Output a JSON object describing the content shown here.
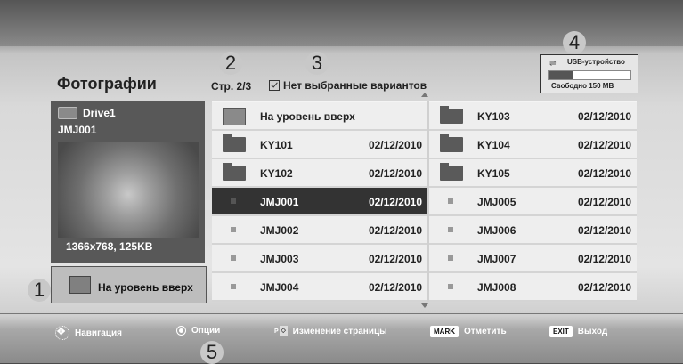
{
  "header": {
    "title": "Фотографии",
    "page": "Стр. 2/3",
    "selection": "Нет выбранные вариантов"
  },
  "callouts": [
    "1",
    "2",
    "3",
    "4",
    "5"
  ],
  "usb": {
    "label": "USB-устройство",
    "free": "Свободно 150 MB",
    "used_fraction": 0.3
  },
  "preview": {
    "drive": "Drive1",
    "file": "JMJ001",
    "info": "1366x768, 125KB"
  },
  "up_button": "На уровень вверх",
  "files": [
    {
      "name": "На уровень вверх",
      "date": "",
      "icon": "up-folder-icon"
    },
    {
      "name": "KY103",
      "date": "02/12/2010",
      "icon": "folder-icon"
    },
    {
      "name": "KY101",
      "date": "02/12/2010",
      "icon": "folder-icon"
    },
    {
      "name": "KY104",
      "date": "02/12/2010",
      "icon": "folder-icon"
    },
    {
      "name": "KY102",
      "date": "02/12/2010",
      "icon": "folder-icon"
    },
    {
      "name": "KY105",
      "date": "02/12/2010",
      "icon": "folder-icon"
    },
    {
      "name": "JMJ001",
      "date": "02/12/2010",
      "icon": "photo-icon",
      "selected": true
    },
    {
      "name": "JMJ005",
      "date": "02/12/2010",
      "icon": "photo-icon"
    },
    {
      "name": "JMJ002",
      "date": "02/12/2010",
      "icon": "photo-icon"
    },
    {
      "name": "JMJ006",
      "date": "02/12/2010",
      "icon": "photo-icon"
    },
    {
      "name": "JMJ003",
      "date": "02/12/2010",
      "icon": "photo-icon"
    },
    {
      "name": "JMJ007",
      "date": "02/12/2010",
      "icon": "photo-icon"
    },
    {
      "name": "JMJ004",
      "date": "02/12/2010",
      "icon": "photo-icon"
    },
    {
      "name": "JMJ008",
      "date": "02/12/2010",
      "icon": "photo-icon"
    }
  ],
  "footer": {
    "nav": "Навигация",
    "options": "Опции",
    "page_key": "P",
    "page_change": "Изменение страницы",
    "mark_key": "MARK",
    "mark": "Отметить",
    "exit_key": "EXIT",
    "exit": "Выход"
  }
}
